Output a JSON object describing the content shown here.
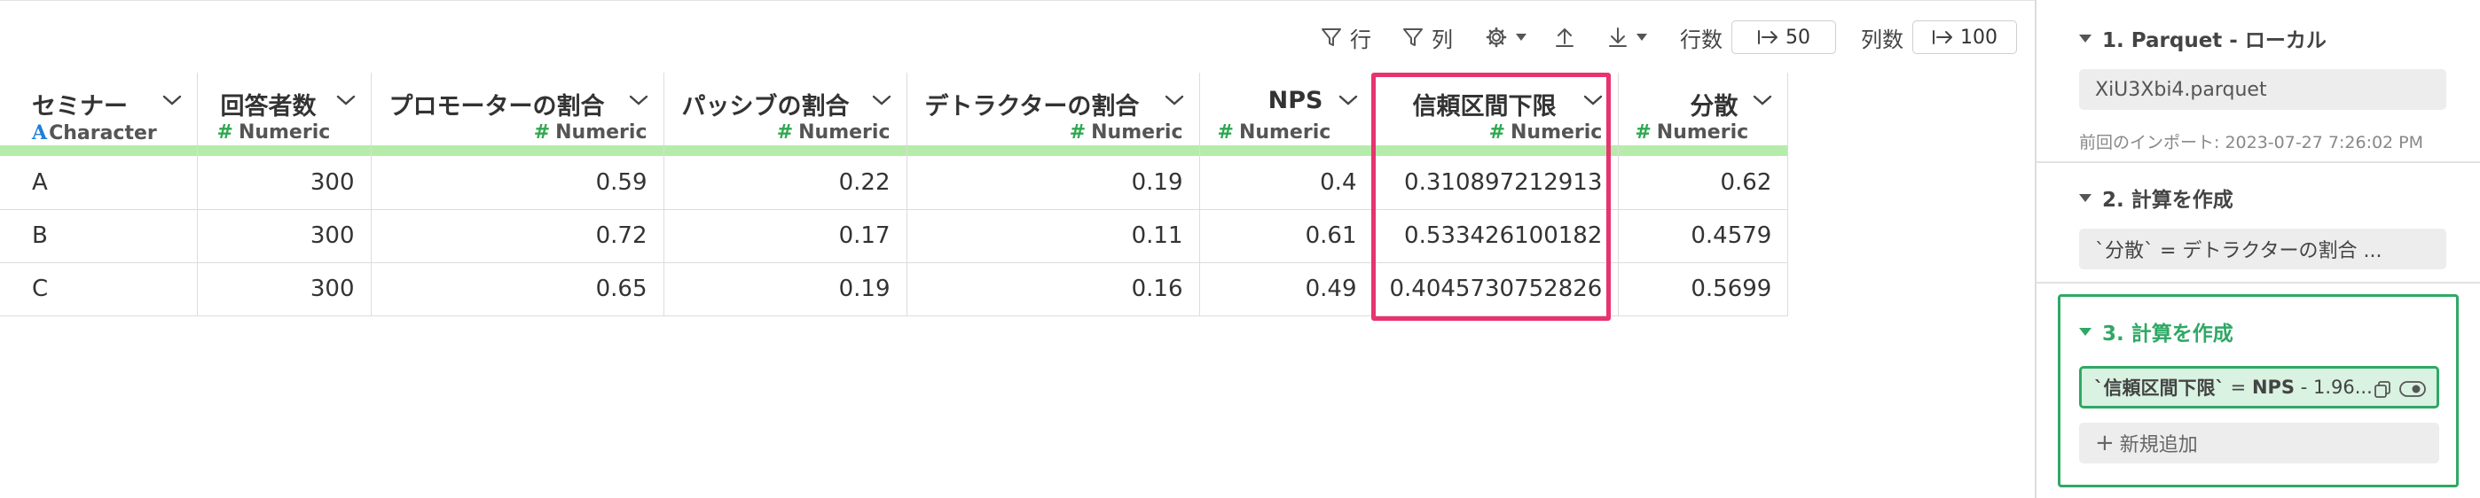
{
  "toolbar": {
    "filter_rows_label": "行",
    "filter_cols_label": "列",
    "rows_label": "行数",
    "rows_value": "50",
    "cols_label": "列数",
    "cols_value": "100"
  },
  "columns": [
    {
      "name": "セミナー",
      "type": "Character",
      "align": "left"
    },
    {
      "name": "回答者数",
      "type": "Numeric",
      "align": "right"
    },
    {
      "name": "プロモーターの割合",
      "type": "Numeric",
      "align": "right"
    },
    {
      "name": "パッシブの割合",
      "type": "Numeric",
      "align": "right"
    },
    {
      "name": "デトラクターの割合",
      "type": "Numeric",
      "align": "right"
    },
    {
      "name": "NPS",
      "type": "Numeric",
      "align": "right"
    },
    {
      "name": "信頼区間下限",
      "type": "Numeric",
      "align": "right"
    },
    {
      "name": "分散",
      "type": "Numeric",
      "align": "right"
    }
  ],
  "rows": [
    [
      "A",
      "300",
      "0.59",
      "0.22",
      "0.19",
      "0.4",
      "0.310897212913",
      "0.62"
    ],
    [
      "B",
      "300",
      "0.72",
      "0.17",
      "0.11",
      "0.61",
      "0.533426100182",
      "0.4579"
    ],
    [
      "C",
      "300",
      "0.65",
      "0.19",
      "0.16",
      "0.49",
      "0.4045730752826",
      "0.5699"
    ]
  ],
  "highlighted_column": "信頼区間下限",
  "steps": [
    {
      "title": "1. Parquet - ローカル",
      "file": "XiU3Xbi4.parquet",
      "meta": "前回のインポート: 2023-07-27 7:26:02 PM"
    },
    {
      "title": "2. 計算を作成",
      "formula": "`分散` = デトラクターの割合 ..."
    },
    {
      "title": "3. 計算を作成",
      "formula_name": "`信頼区間下限`",
      "formula_eq": " = ",
      "formula_bold": "NPS",
      "formula_rest": " - 1.96...",
      "add_label": "新規追加"
    }
  ],
  "colors": {
    "accent_green": "#2fa865",
    "highlight_pink": "#e8336f",
    "type_bar_green": "#b6ecaa",
    "numeric_hash": "#2fa84f",
    "character_a": "#1e7fd6"
  }
}
